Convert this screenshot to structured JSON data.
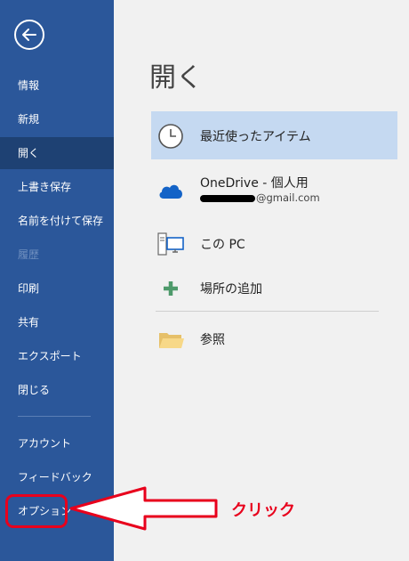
{
  "sidebar": {
    "back_icon": "arrow-left-icon",
    "items": [
      {
        "label": "情報"
      },
      {
        "label": "新規"
      },
      {
        "label": "開く"
      },
      {
        "label": "上書き保存"
      },
      {
        "label": "名前を付けて保存"
      },
      {
        "label": "履歴"
      },
      {
        "label": "印刷"
      },
      {
        "label": "共有"
      },
      {
        "label": "エクスポート"
      },
      {
        "label": "閉じる"
      },
      {
        "label": "アカウント"
      },
      {
        "label": "フィードバック"
      },
      {
        "label": "オプション"
      }
    ]
  },
  "main": {
    "title": "開く",
    "locations": [
      {
        "label": "最近使ったアイテム",
        "icon": "clock-icon"
      },
      {
        "label": "OneDrive - 個人用",
        "sub": "@gmail.com",
        "icon": "cloud-icon"
      },
      {
        "label": "この PC",
        "icon": "computer-icon"
      },
      {
        "label": "場所の追加",
        "icon": "plus-icon"
      },
      {
        "label": "参照",
        "icon": "folder-icon"
      }
    ]
  },
  "annotation": {
    "text": "クリック",
    "color": "#e8001c"
  },
  "colors": {
    "sidebar": "#2b579a",
    "sidebar_active": "#1e4173",
    "selected_location": "#c5d9f1"
  }
}
